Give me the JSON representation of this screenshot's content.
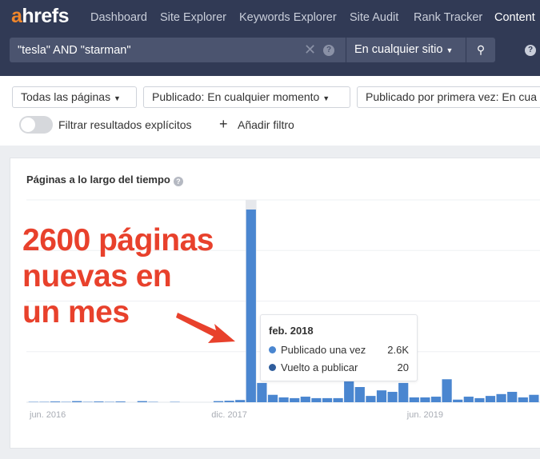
{
  "header": {
    "logo": "ahrefs",
    "nav": [
      "Dashboard",
      "Site Explorer",
      "Keywords Explorer",
      "Site Audit",
      "Rank Tracker",
      "Content"
    ],
    "search_value": "\"tesla\" AND \"starman\"",
    "scope": "En cualquier sitio",
    "help": "?"
  },
  "filters": {
    "pages": "Todas las páginas",
    "published": "Publicado: En cualquier momento",
    "first_published": "Publicado por primera vez: En cua",
    "explicit": "Filtrar resultados explícitos",
    "add_filter": "Añadir filtro"
  },
  "annotation": [
    "2600 páginas",
    "nuevas en",
    "un mes"
  ],
  "tooltip": {
    "title": "feb. 2018",
    "rows": [
      {
        "label": "Publicado una vez",
        "value": "2.6K",
        "color": "#4a86d0"
      },
      {
        "label": "Vuelto a publicar",
        "value": "20",
        "color": "#2f5d9c"
      }
    ]
  },
  "chart_data": {
    "type": "bar",
    "title": "Páginas a lo largo del tiempo",
    "start_month": "jun. 2016",
    "x_tick_labels": [
      {
        "index": 0,
        "label": "jun. 2016"
      },
      {
        "index": 18,
        "label": "dic. 2017"
      },
      {
        "index": 36,
        "label": "jun. 2019"
      }
    ],
    "ylim": [
      0,
      2730
    ],
    "grid": true,
    "series": [
      {
        "name": "Publicado una vez",
        "color": "#4a86d0",
        "values": [
          5,
          5,
          10,
          5,
          15,
          5,
          10,
          5,
          10,
          0,
          15,
          5,
          0,
          5,
          0,
          0,
          0,
          15,
          20,
          30,
          2600,
          260,
          100,
          65,
          55,
          75,
          55,
          55,
          55,
          280,
          205,
          85,
          160,
          140,
          260,
          65,
          65,
          75,
          310,
          35,
          75,
          55,
          85,
          110,
          140,
          65,
          100
        ]
      }
    ]
  }
}
